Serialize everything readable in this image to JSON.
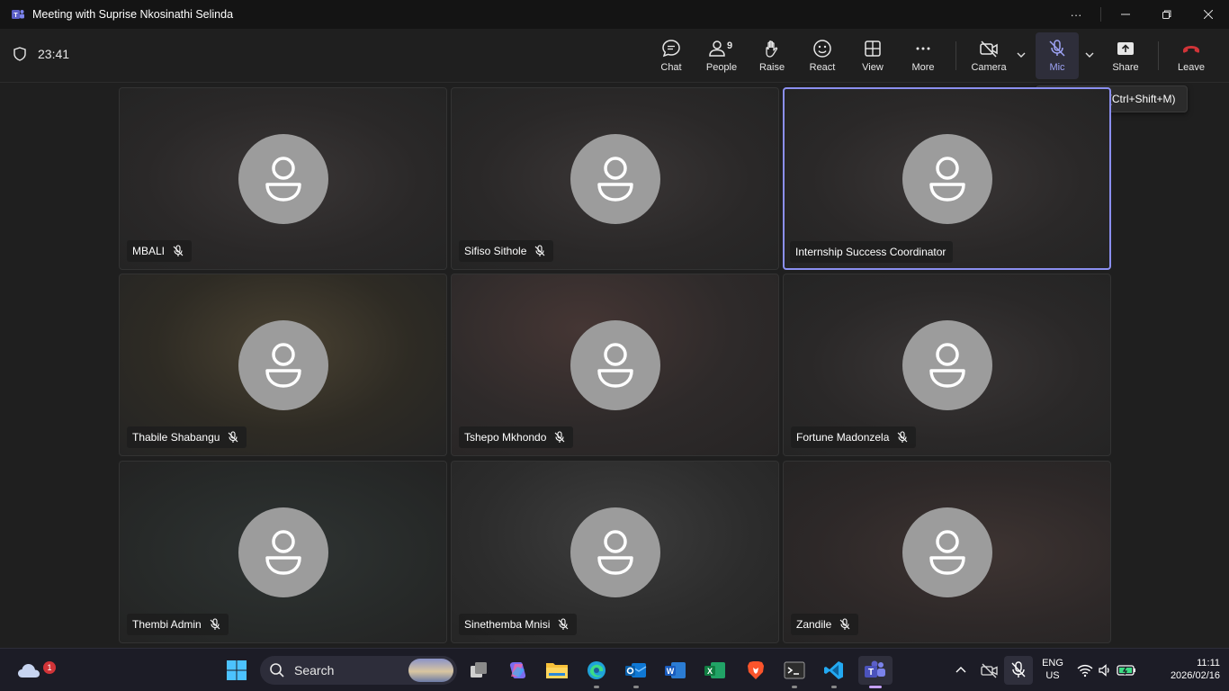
{
  "window": {
    "title": "Meeting with Suprise Nkosinathi Selinda",
    "more_icon": "ellipsis-icon",
    "minimize_icon": "minimize-icon",
    "restore_icon": "restore-icon",
    "close_icon": "close-icon"
  },
  "meeting": {
    "elapsed": "23:41"
  },
  "toolbar": {
    "chat": "Chat",
    "people": "People",
    "people_count": "9",
    "raise": "Raise",
    "react": "React",
    "view": "View",
    "more": "More",
    "camera": "Camera",
    "mic": "Mic",
    "share": "Share",
    "leave": "Leave",
    "leave_color": "#d13438",
    "mic_accent": "#9ea3f5"
  },
  "tooltip": {
    "text": "Unmute mic (Ctrl+Shift+M)"
  },
  "participants": [
    {
      "name": "MBALI",
      "muted": true,
      "active": false
    },
    {
      "name": "Sifiso Sithole",
      "muted": true,
      "active": false
    },
    {
      "name": "Internship Success Coordinator",
      "muted": false,
      "active": true
    },
    {
      "name": "Thabile Shabangu",
      "muted": true,
      "active": false
    },
    {
      "name": "Tshepo Mkhondo",
      "muted": true,
      "active": false
    },
    {
      "name": "Fortune Madonzela",
      "muted": true,
      "active": false
    },
    {
      "name": "Thembi Admin",
      "muted": true,
      "active": false
    },
    {
      "name": "Sinethemba Mnisi",
      "muted": true,
      "active": false
    },
    {
      "name": "Zandile",
      "muted": true,
      "active": false
    }
  ],
  "taskbar": {
    "weather_badge": "1",
    "search_label": "Search",
    "apps": [
      "task-view",
      "copilot",
      "file-explorer",
      "edge",
      "outlook",
      "word",
      "excel",
      "brave",
      "terminal",
      "vscode",
      "teams"
    ],
    "language": "ENG",
    "region": "US",
    "time": "11:11",
    "date": "2026/02/16",
    "active_accent": "#c6a0ff"
  }
}
